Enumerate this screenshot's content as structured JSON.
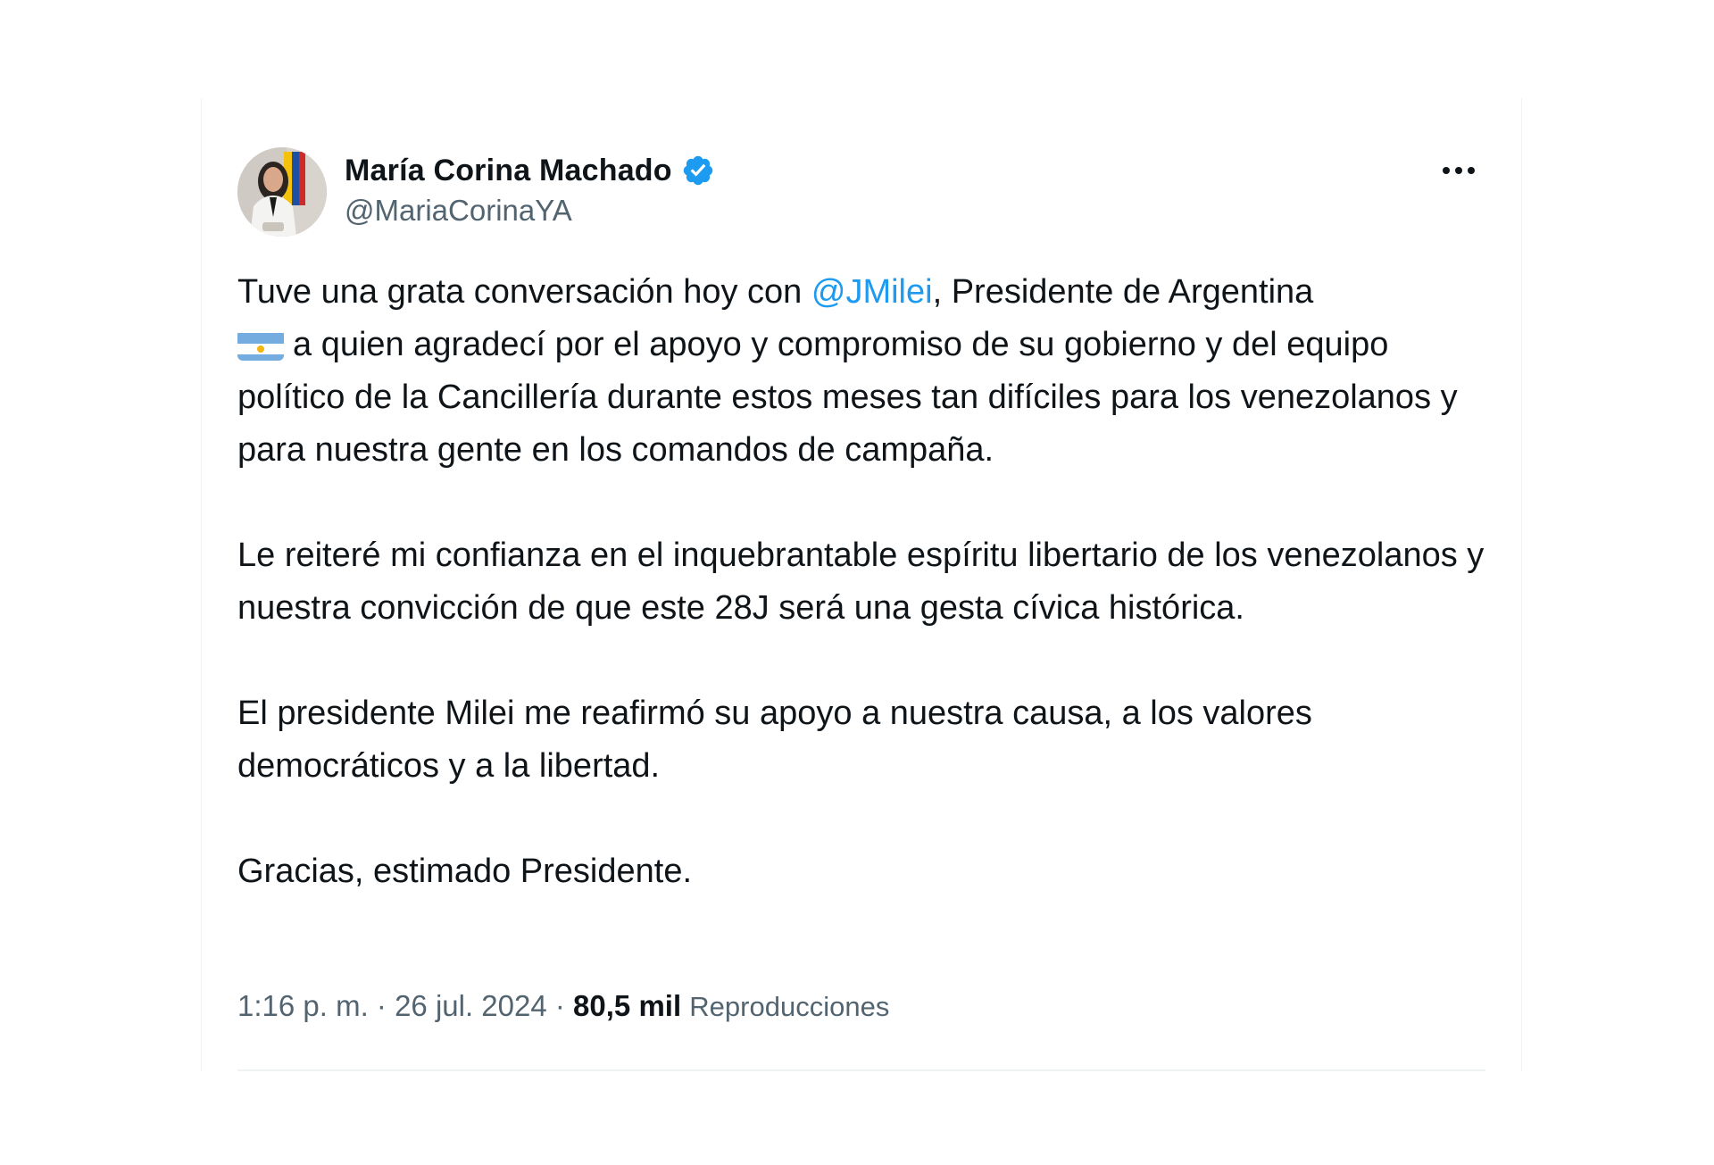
{
  "author": {
    "display_name": "María Corina Machado",
    "handle": "@MariaCorinaYA",
    "verified": true,
    "verified_color": "#1d9bf0"
  },
  "tweet": {
    "p1_before_mention": "Tuve una grata conversación hoy con ",
    "mention": "@JMilei",
    "p1_after_mention": ", Presidente de Argentina",
    "p1_flag_icon": "argentina-flag-emoji",
    "p1_after_flag": "a quien agradecí por el apoyo y compromiso de su gobierno y del equipo político de la Cancillería durante estos meses tan difíciles para los venezolanos y para nuestra gente en los comandos de campaña.",
    "p2": "Le reiteré mi confianza en el inquebrantable espíritu libertario de los venezolanos y nuestra convicción de que este 28J será una gesta cívica histórica.",
    "p3": "El presidente Milei me reafirmó su apoyo a nuestra causa, a los valores democráticos y a la libertad.",
    "p4": "Gracias, estimado Presidente."
  },
  "meta": {
    "time": "1:16 p. m.",
    "separator": " · ",
    "date": "26 jul. 2024",
    "views_count": "80,5 mil",
    "views_label": "Reproducciones"
  },
  "icons": {
    "more": "more-horizontal-icon",
    "verified": "verified-badge-icon"
  },
  "colors": {
    "text": "#0f1419",
    "secondary": "#536471",
    "link": "#1d9bf0"
  }
}
